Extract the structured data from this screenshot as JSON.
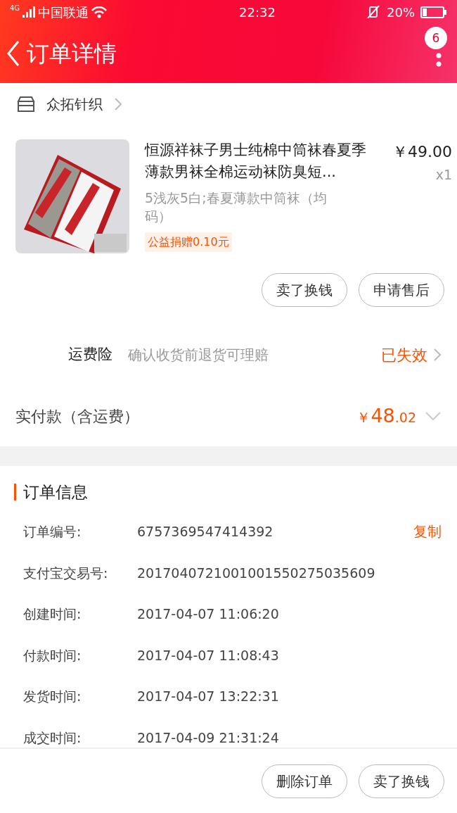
{
  "status_bar": {
    "network": "4G",
    "carrier": "中国联通",
    "time": "22:32",
    "battery": "20%"
  },
  "header": {
    "title": "订单详情",
    "badge": "6"
  },
  "shop": {
    "name": "众拓针织"
  },
  "product": {
    "title": "恒源祥袜子男士纯棉中筒袜春夏季薄款男袜全棉运动袜防臭短...",
    "price": "￥49.00",
    "quantity": "x1",
    "sku": "5浅灰5白;春夏薄款中筒袜（均码）",
    "charity": "公益捐赠0.10元"
  },
  "item_buttons": [
    "卖了换钱",
    "申请售后"
  ],
  "insurance": {
    "label": "运费险",
    "description": "确认收货前退货可理赔",
    "status": "已失效"
  },
  "paid": {
    "label": "实付款（含运费）",
    "currency": "￥",
    "amount_int": "48",
    "amount_dec": ".02"
  },
  "order_info": {
    "title": "订单信息",
    "rows": [
      {
        "label": "订单编号:",
        "value": "6757369547414392",
        "action": "复制"
      },
      {
        "label": "支付宝交易号:",
        "value": "2017040721001001550275035609"
      },
      {
        "label": "创建时间:",
        "value": "2017-04-07 11:06:20"
      },
      {
        "label": "付款时间:",
        "value": "2017-04-07 11:08:43"
      },
      {
        "label": "发货时间:",
        "value": "2017-04-07 13:22:31"
      },
      {
        "label": "成交时间:",
        "value": "2017-04-09 21:31:24"
      }
    ]
  },
  "bottom_buttons": [
    "删除订单",
    "卖了换钱"
  ]
}
